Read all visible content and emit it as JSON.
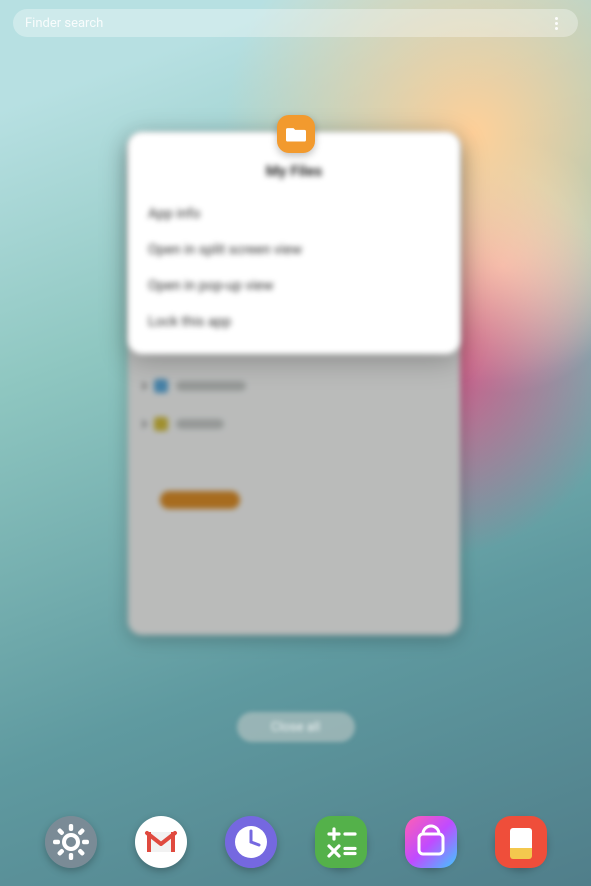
{
  "search": {
    "placeholder": "Finder search"
  },
  "popup": {
    "app_name": "My Files",
    "items": [
      {
        "label": "App info"
      },
      {
        "label": "Open in split screen view"
      },
      {
        "label": "Open in pop-up view"
      },
      {
        "label": "Lock this app"
      }
    ]
  },
  "close_all_label": "Close all",
  "dock": [
    {
      "name": "Settings",
      "icon": "settings-icon"
    },
    {
      "name": "Gmail",
      "icon": "gmail-icon"
    },
    {
      "name": "Clock",
      "icon": "clock-icon"
    },
    {
      "name": "Calculator",
      "icon": "calculator-icon"
    },
    {
      "name": "Galaxy Store",
      "icon": "galaxy-store-icon"
    },
    {
      "name": "Samsung Notes",
      "icon": "samsung-notes-icon"
    }
  ]
}
